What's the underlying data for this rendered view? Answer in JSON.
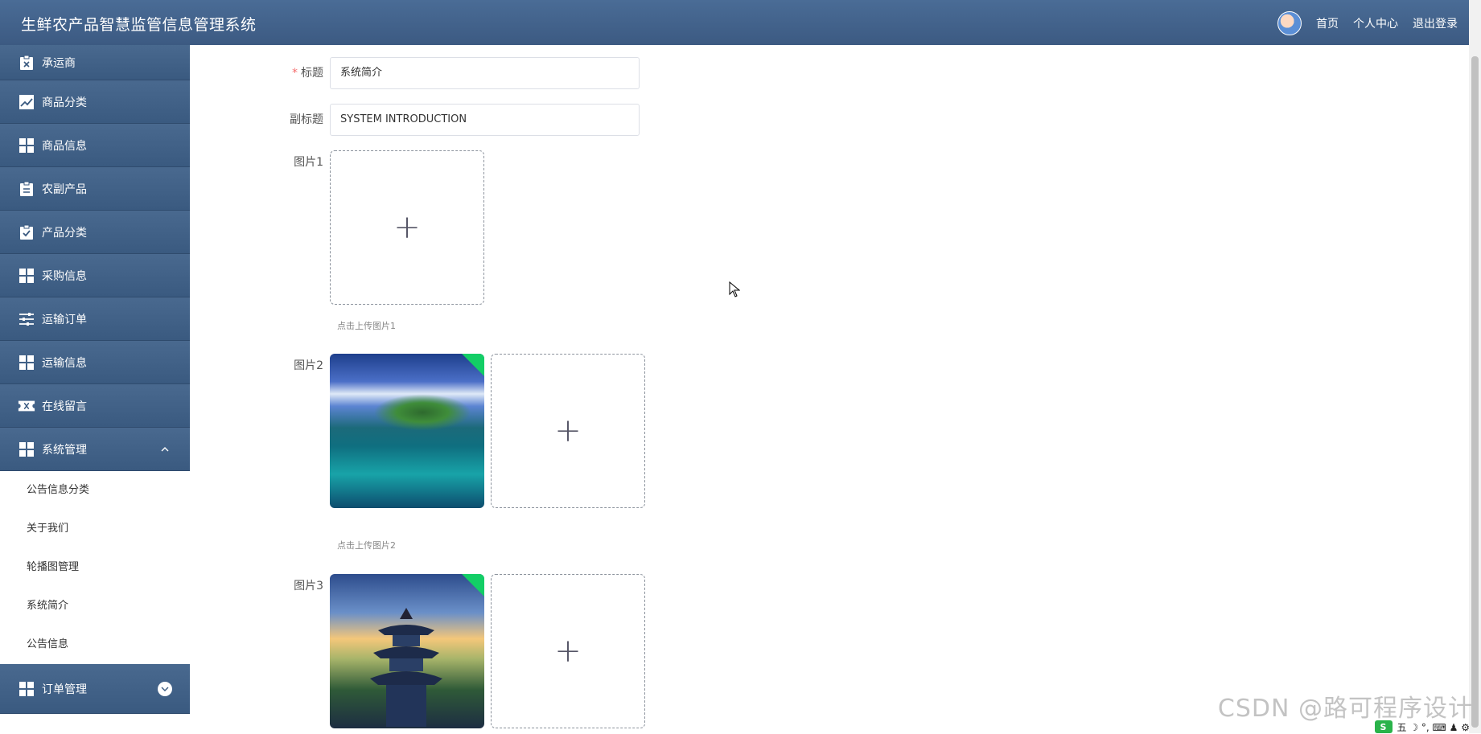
{
  "app": {
    "title": "生鲜农产品智慧监管信息管理系统"
  },
  "header": {
    "links": [
      "首页",
      "个人中心",
      "退出登录"
    ]
  },
  "sidebar": {
    "items": [
      {
        "label": "承运商",
        "icon": "clipboard-x-icon"
      },
      {
        "label": "商品分类",
        "icon": "line-chart-icon"
      },
      {
        "label": "商品信息",
        "icon": "grid-icon"
      },
      {
        "label": "农副产品",
        "icon": "clipboard-list-icon"
      },
      {
        "label": "产品分类",
        "icon": "clipboard-check-icon"
      },
      {
        "label": "采购信息",
        "icon": "grid-icon"
      },
      {
        "label": "运输订单",
        "icon": "sliders-icon"
      },
      {
        "label": "运输信息",
        "icon": "grid-icon"
      },
      {
        "label": "在线留言",
        "icon": "ticket-icon"
      },
      {
        "label": "系统管理",
        "icon": "grid-icon",
        "expanded": true
      }
    ],
    "sub_items": [
      "公告信息分类",
      "关于我们",
      "轮播图管理",
      "系统简介",
      "公告信息"
    ],
    "last_item": {
      "label": "订单管理",
      "icon": "grid-icon"
    }
  },
  "form": {
    "title_label": "标题",
    "title_value": "系统简介",
    "subtitle_label": "副标题",
    "subtitle_value": "SYSTEM INTRODUCTION",
    "pic1_label": "图片1",
    "pic1_hint": "点击上传图片1",
    "pic2_label": "图片2",
    "pic2_hint": "点击上传图片2",
    "pic3_label": "图片3"
  },
  "overlay": {
    "watermark": "CSDN @路可程序设计",
    "tray_logo": "S",
    "tray_text": "五 ☽ °, ⌨ ♟ ⚙"
  }
}
